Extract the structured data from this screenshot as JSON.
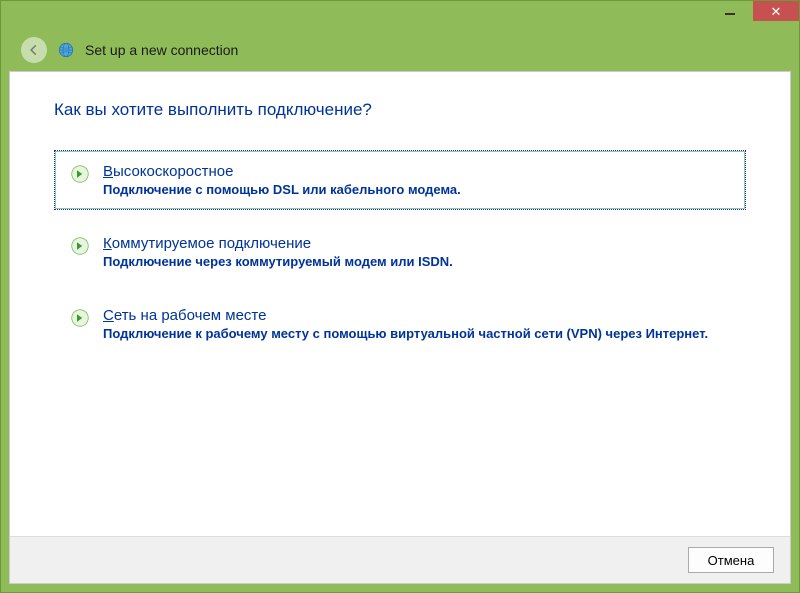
{
  "titlebar": {},
  "header": {
    "title": "Set up a new connection"
  },
  "main": {
    "heading": "Как вы хотите выполнить подключение?",
    "options": [
      {
        "title_u": "В",
        "title_rest": "ысокоскоростное",
        "desc": "Подключение с помощью DSL или кабельного модема."
      },
      {
        "title_u": "К",
        "title_rest": "оммутируемое подключение",
        "desc": "Подключение через коммутируемый модем или ISDN."
      },
      {
        "title_u": "С",
        "title_rest": "еть на рабочем месте",
        "desc": "Подключение к рабочему месту с помощью виртуальной частной сети (VPN) через Интернет."
      }
    ]
  },
  "footer": {
    "cancel_label": "Отмена"
  }
}
